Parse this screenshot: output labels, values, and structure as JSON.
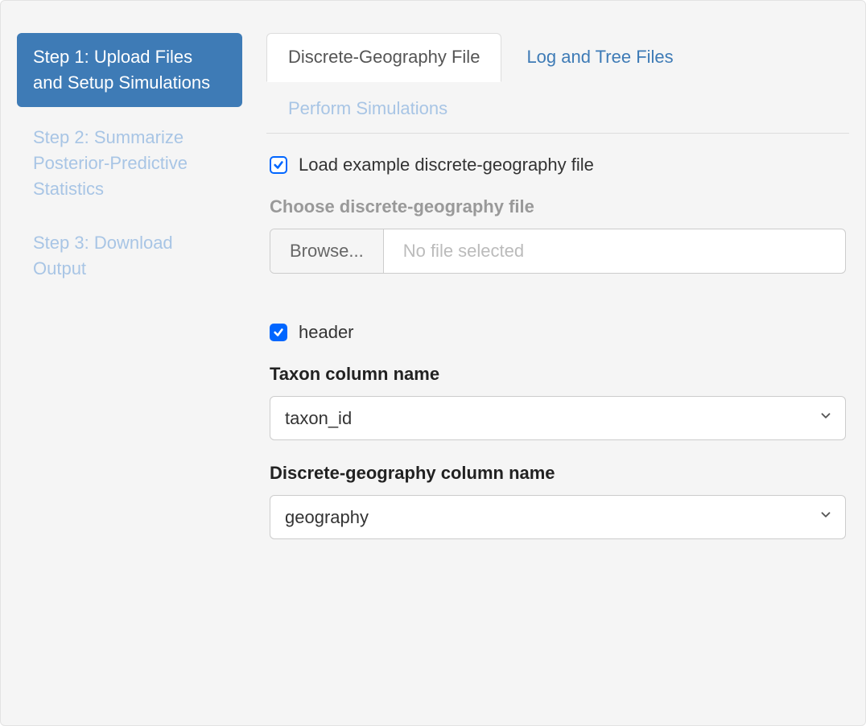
{
  "sidebar": {
    "items": [
      {
        "label": "Step 1: Upload Files and Setup Simulations",
        "active": true
      },
      {
        "label": "Step 2: Summarize Posterior-Predictive Statistics",
        "active": false
      },
      {
        "label": "Step 3: Download Output",
        "active": false
      }
    ]
  },
  "tabs": {
    "items": [
      {
        "label": "Discrete-Geography File",
        "state": "active"
      },
      {
        "label": "Log and Tree Files",
        "state": "normal"
      },
      {
        "label": "Perform Simulations",
        "state": "disabled"
      }
    ]
  },
  "form": {
    "load_example_label": "Load example discrete-geography file",
    "load_example_checked": true,
    "choose_file_label": "Choose discrete-geography file",
    "browse_label": "Browse...",
    "file_status": "No file selected",
    "header_label": "header",
    "header_checked": true,
    "taxon_label": "Taxon column name",
    "taxon_value": "taxon_id",
    "geo_label": "Discrete-geography column name",
    "geo_value": "geography"
  }
}
